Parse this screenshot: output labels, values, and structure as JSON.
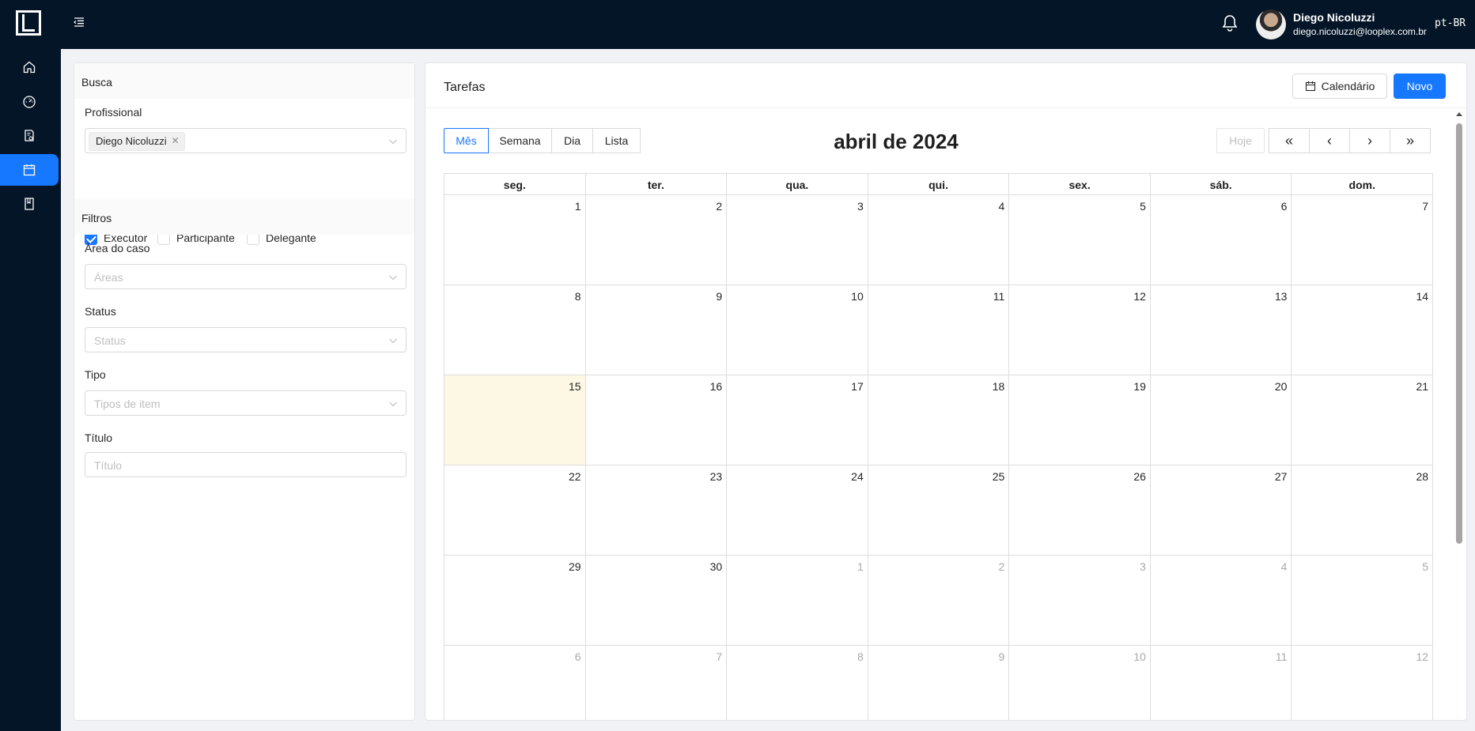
{
  "header": {
    "user_name": "Diego Nicoluzzi",
    "user_email": "diego.nicoluzzi@looplex.com.br",
    "language": "pt-BR"
  },
  "sidebar": {
    "items": [
      {
        "icon": "home-icon",
        "active": false
      },
      {
        "icon": "dashboard-icon",
        "active": false
      },
      {
        "icon": "document-search-icon",
        "active": false
      },
      {
        "icon": "calendar-icon",
        "active": true
      },
      {
        "icon": "book-icon",
        "active": false
      }
    ]
  },
  "filters": {
    "search_section": "Busca",
    "professional_label": "Profissional",
    "professional_tag": "Diego Nicoluzzi",
    "roles": [
      {
        "label": "Executor",
        "checked": true
      },
      {
        "label": "Participante",
        "checked": false
      },
      {
        "label": "Delegante",
        "checked": false
      }
    ],
    "filters_section": "Filtros",
    "area_label": "Área do caso",
    "area_placeholder": "Áreas",
    "status_label": "Status",
    "status_placeholder": "Status",
    "type_label": "Tipo",
    "type_placeholder": "Tipos de item",
    "title_label": "Título",
    "title_placeholder": "Título"
  },
  "main": {
    "title": "Tarefas",
    "calendar_button": "Calendário",
    "new_button": "Novo",
    "views": [
      "Mês",
      "Semana",
      "Dia",
      "Lista"
    ],
    "active_view": "Mês",
    "period_title": "abril de 2024",
    "today_button": "Hoje",
    "nav_buttons": [
      "«",
      "‹",
      "›",
      "»"
    ]
  },
  "calendar": {
    "weekdays": [
      "seg.",
      "ter.",
      "qua.",
      "qui.",
      "sex.",
      "sáb.",
      "dom."
    ],
    "today": 15,
    "weeks": [
      [
        {
          "d": 1
        },
        {
          "d": 2
        },
        {
          "d": 3
        },
        {
          "d": 4
        },
        {
          "d": 5
        },
        {
          "d": 6
        },
        {
          "d": 7
        }
      ],
      [
        {
          "d": 8
        },
        {
          "d": 9
        },
        {
          "d": 10
        },
        {
          "d": 11
        },
        {
          "d": 12
        },
        {
          "d": 13
        },
        {
          "d": 14
        }
      ],
      [
        {
          "d": 15
        },
        {
          "d": 16
        },
        {
          "d": 17
        },
        {
          "d": 18
        },
        {
          "d": 19
        },
        {
          "d": 20
        },
        {
          "d": 21
        }
      ],
      [
        {
          "d": 22
        },
        {
          "d": 23
        },
        {
          "d": 24
        },
        {
          "d": 25
        },
        {
          "d": 26
        },
        {
          "d": 27
        },
        {
          "d": 28
        }
      ],
      [
        {
          "d": 29
        },
        {
          "d": 30
        },
        {
          "d": 1,
          "other": true
        },
        {
          "d": 2,
          "other": true
        },
        {
          "d": 3,
          "other": true
        },
        {
          "d": 4,
          "other": true
        },
        {
          "d": 5,
          "other": true
        }
      ],
      [
        {
          "d": 6,
          "other": true
        },
        {
          "d": 7,
          "other": true
        },
        {
          "d": 8,
          "other": true
        },
        {
          "d": 9,
          "other": true
        },
        {
          "d": 10,
          "other": true
        },
        {
          "d": 11,
          "other": true
        },
        {
          "d": 12,
          "other": true
        }
      ]
    ]
  }
}
